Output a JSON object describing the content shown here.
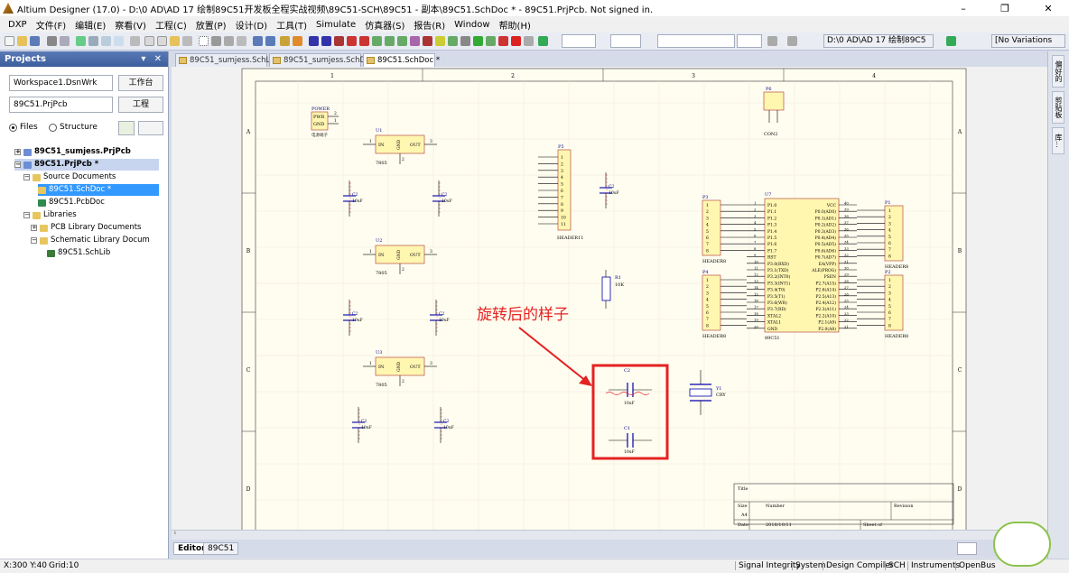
{
  "app": {
    "title": "Altium Designer (17.0) - D:\\0 AD\\AD 17 绘制89C51开发板全程实战视频\\89C51-SCH\\89C51 - 副本\\89C51.SchDoc * - 89C51.PrjPcb. Not signed in.",
    "window_controls": {
      "minimize": "–",
      "restore": "❐",
      "close": "✕"
    }
  },
  "menu": [
    "DXP",
    "文件(F)",
    "编辑(E)",
    "察看(V)",
    "工程(C)",
    "放置(P)",
    "设计(D)",
    "工具(T)",
    "Simulate",
    "仿真器(S)",
    "报告(R)",
    "Window",
    "帮助(H)"
  ],
  "toolbar": {
    "path_combo": "D:\\0 AD\\AD 17 绘制89C5",
    "variations_combo": "[No Variations"
  },
  "projects_panel": {
    "title": "Projects",
    "header_buttons": "▾ ✕",
    "workspace": "Workspace1.DsnWrk",
    "workspace_button": "工作台",
    "project": "89C51.PrjPcb",
    "project_button": "工程",
    "radio_files": "Files",
    "radio_structure": "Structure",
    "tree": [
      {
        "label": "89C51_sumjess.PrjPcb",
        "level": 0,
        "bold": true,
        "exp": "+"
      },
      {
        "label": "89C51.PrjPcb *",
        "level": 0,
        "bold": true,
        "exp": "−",
        "selected_row": true
      },
      {
        "label": "Source Documents",
        "level": 1,
        "exp": "−"
      },
      {
        "label": "89C51.SchDoc *",
        "level": 2,
        "selected": true
      },
      {
        "label": "89C51.PcbDoc",
        "level": 2
      },
      {
        "label": "Libraries",
        "level": 1,
        "exp": "−"
      },
      {
        "label": "PCB Library Documents",
        "level": 2,
        "exp": "+"
      },
      {
        "label": "Schematic Library Docum",
        "level": 2,
        "exp": "−"
      },
      {
        "label": "89C51.SchLib",
        "level": 3
      }
    ]
  },
  "doc_tabs": [
    {
      "label": "89C51_sumjess.SchLib",
      "active": false
    },
    {
      "label": "89C51_sumjess.SchDoc",
      "active": false
    },
    {
      "label": "89C51.SchDoc *",
      "active": true
    }
  ],
  "bottom_tabs": [
    "Editor",
    "89C51"
  ],
  "right_strip": [
    "偏好的",
    "剪贴板",
    "库..."
  ],
  "schematic": {
    "col_labels": [
      "1",
      "2",
      "3",
      "4"
    ],
    "row_labels": [
      "A",
      "B",
      "C",
      "D"
    ],
    "power": {
      "ref": "POWER",
      "pins": [
        "PWR",
        "GND"
      ],
      "pin_nums": [
        "2",
        "1"
      ],
      "desc": "电源端子"
    },
    "p6": {
      "ref": "P6",
      "name": "CON2",
      "pin_nums": [
        "1",
        "2"
      ]
    },
    "regulators": [
      {
        "ref": "U1",
        "name": "7805",
        "pin_in": "IN",
        "pin_gnd": "GND",
        "pin_out": "OUT",
        "n1": "1",
        "n3": "3",
        "n2": "2"
      },
      {
        "ref": "U2",
        "name": "7805",
        "pin_in": "IN",
        "pin_gnd": "GND",
        "pin_out": "OUT",
        "n1": "1",
        "n3": "3",
        "n2": "2"
      },
      {
        "ref": "U3",
        "name": "7805",
        "pin_in": "IN",
        "pin_gnd": "GND",
        "pin_out": "OUT",
        "n1": "1",
        "n3": "3",
        "n2": "2"
      }
    ],
    "capacitors": [
      {
        "ref": "C2",
        "value": "10uF"
      },
      {
        "ref": "C2",
        "value": "10uF"
      },
      {
        "ref": "C2",
        "value": "10uF"
      },
      {
        "ref": "C2",
        "value": "10uF"
      },
      {
        "ref": "C2",
        "value": "10uF"
      },
      {
        "ref": "C2",
        "value": "10uF"
      },
      {
        "ref": "C2",
        "value": "10uF"
      }
    ],
    "p5": {
      "ref": "P5",
      "name": "HEADER11",
      "pins": [
        "1",
        "2",
        "3",
        "4",
        "5",
        "6",
        "7",
        "8",
        "9",
        "10",
        "11"
      ]
    },
    "r1": {
      "ref": "R1",
      "value": "10K"
    },
    "u7": {
      "ref": "U7",
      "name": "89C51",
      "left_pins": [
        "P1.0",
        "P1.1",
        "P1.2",
        "P1.3",
        "P1.4",
        "P1.5",
        "P1.6",
        "P1.7",
        "RST",
        "P3.0(RXD)",
        "P3.1(TXD)",
        "P3.2(INT0)",
        "P3.3(INT1)",
        "P3.4(T0)",
        "P3.5(T1)",
        "P3.6(WR)",
        "P3.7(RD)",
        "XTAL2",
        "XTAL1",
        "GND"
      ],
      "right_pins": [
        "VCC",
        "P0.0(AD0)",
        "P0.1(AD1)",
        "P0.2(AD2)",
        "P0.3(AD3)",
        "P0.4(AD4)",
        "P0.5(AD5)",
        "P0.6(AD6)",
        "P0.7(AD7)",
        "EA(VPP)",
        "ALE(PROG)",
        "PSEN",
        "P2.7(A15)",
        "P2.6(A14)",
        "P2.5(A13)",
        "P2.4(A12)",
        "P2.3(A11)",
        "P2.2(A10)",
        "P2.1(A9)",
        "P2.0(A8)"
      ],
      "left_nums": [
        "1",
        "2",
        "3",
        "4",
        "5",
        "6",
        "7",
        "8",
        "9",
        "10",
        "11",
        "12",
        "13",
        "14",
        "15",
        "16",
        "17",
        "18",
        "19",
        "20"
      ],
      "right_nums": [
        "40",
        "39",
        "38",
        "37",
        "36",
        "35",
        "34",
        "33",
        "32",
        "31",
        "30",
        "29",
        "28",
        "27",
        "26",
        "25",
        "24",
        "23",
        "22",
        "21"
      ]
    },
    "p3": {
      "ref": "P3",
      "name": "HEADER8",
      "pins": [
        "1",
        "2",
        "3",
        "4",
        "5",
        "6",
        "7",
        "8"
      ]
    },
    "p4": {
      "ref": "P4",
      "name": "HEADER8",
      "pins": [
        "1",
        "2",
        "3",
        "4",
        "5",
        "6",
        "7",
        "8"
      ]
    },
    "p1": {
      "ref": "P1",
      "name": "HEADER8",
      "pins": [
        "1",
        "2",
        "3",
        "4",
        "5",
        "6",
        "7",
        "8"
      ]
    },
    "p2": {
      "ref": "P2",
      "name": "HEADER8",
      "pins": [
        "1",
        "2",
        "3",
        "4",
        "5",
        "6",
        "7",
        "8"
      ]
    },
    "y1": {
      "ref": "Y1",
      "name": "CRY"
    },
    "rotated_c2": {
      "ref": "C2",
      "value": "10uF"
    },
    "rotated_c1": {
      "ref": "C1",
      "value": "10uF"
    },
    "annotation": "旋转后的样子",
    "title_block": {
      "title": "Title",
      "size": "Size",
      "size_val": "A4",
      "number": "Number",
      "revision": "Revision",
      "date": "Date",
      "date_val": "2018/10/11",
      "sheet": "Sheet    of"
    }
  },
  "status": {
    "coords": "X:300 Y:40",
    "grid": "Grid:10",
    "right": [
      "Signal Integrity",
      "System",
      "Design Compiler",
      "SCH",
      "Instruments",
      "OpenBus"
    ]
  },
  "colors": {
    "accent": "#3d5e9d",
    "schematic_wire": "#0000aa",
    "component_fill": "#fff6b0",
    "annotation_red": "#e52222"
  }
}
